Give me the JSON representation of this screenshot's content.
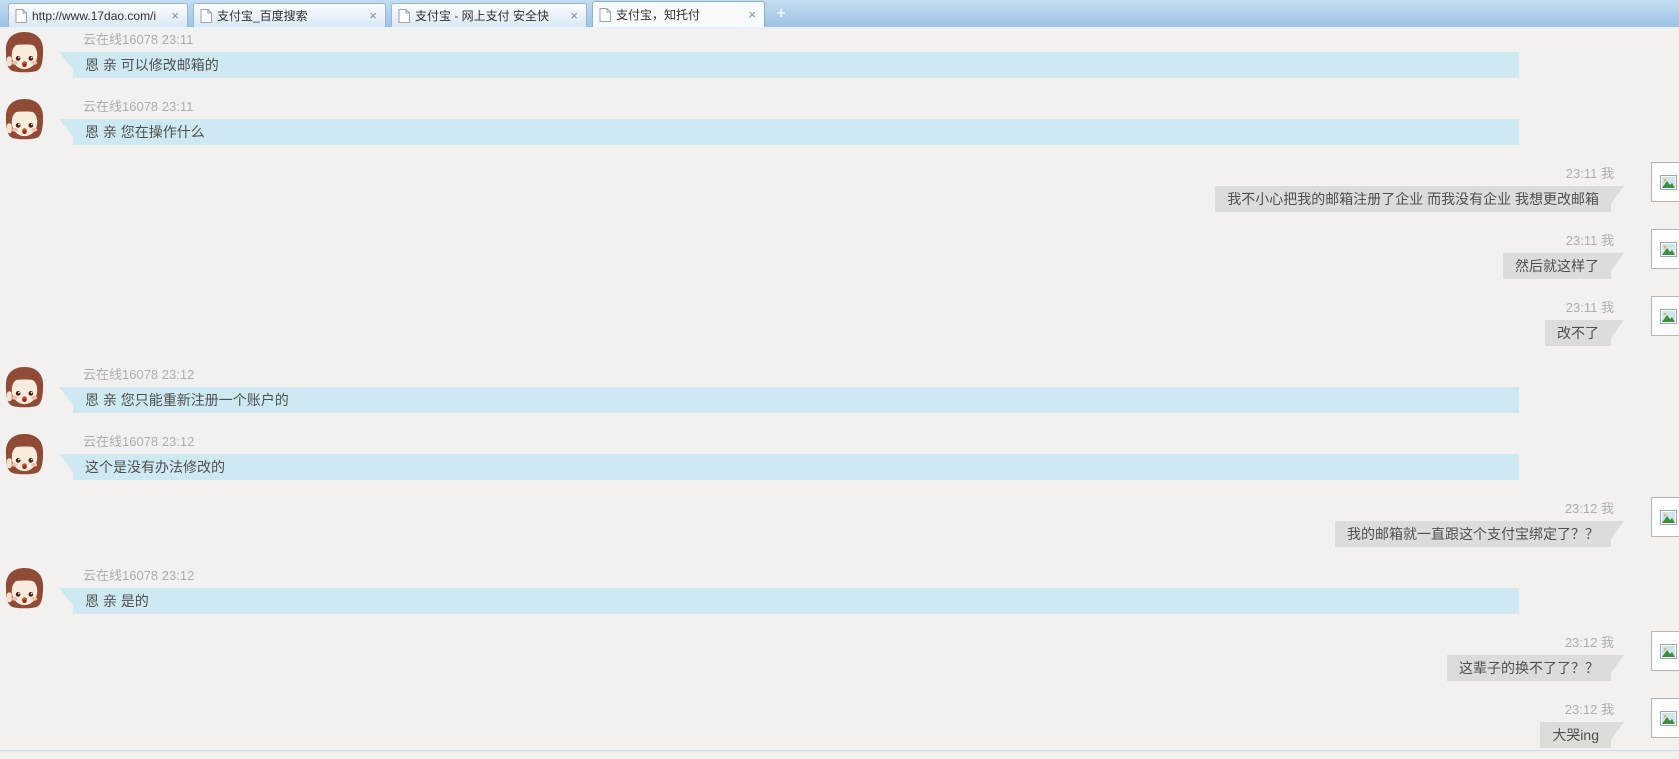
{
  "browser": {
    "tabs": [
      {
        "title": "http://www.17dao.com/i",
        "active": false
      },
      {
        "title": "支付宝_百度搜索",
        "active": false
      },
      {
        "title": "支付宝 - 网上支付 安全快",
        "active": false
      },
      {
        "title": "支付宝，知托付",
        "active": true
      }
    ],
    "close_glyph": "×",
    "new_tab_glyph": "+"
  },
  "chat": {
    "agent_name": "云在线16078",
    "self_label": "我",
    "messages": [
      {
        "from": "agent",
        "time": "23:11",
        "text": "恩 亲 可以修改邮箱的"
      },
      {
        "from": "agent",
        "time": "23:11",
        "text": "恩 亲 您在操作什么"
      },
      {
        "from": "self",
        "time": "23:11",
        "text": "我不小心把我的邮箱注册了企业 而我没有企业 我想更改邮箱"
      },
      {
        "from": "self",
        "time": "23:11",
        "text": "然后就这样了"
      },
      {
        "from": "self",
        "time": "23:11",
        "text": "改不了"
      },
      {
        "from": "agent",
        "time": "23:12",
        "text": "恩 亲 您只能重新注册一个账户的"
      },
      {
        "from": "agent",
        "time": "23:12",
        "text": "这个是没有办法修改的"
      },
      {
        "from": "self",
        "time": "23:12",
        "text": "我的邮箱就一直跟这个支付宝绑定了？？"
      },
      {
        "from": "agent",
        "time": "23:12",
        "text": "恩 亲 是的"
      },
      {
        "from": "self",
        "time": "23:12",
        "text": "这辈子的换不了了？？"
      },
      {
        "from": "self",
        "time": "23:12",
        "text": "大哭ing"
      }
    ],
    "colors": {
      "agent_bubble": "#cfe9f2",
      "self_bubble": "#dcdcda",
      "background": "#f2f1ef",
      "header_text": "#aeaeae",
      "message_text": "#4f4f4f"
    }
  }
}
